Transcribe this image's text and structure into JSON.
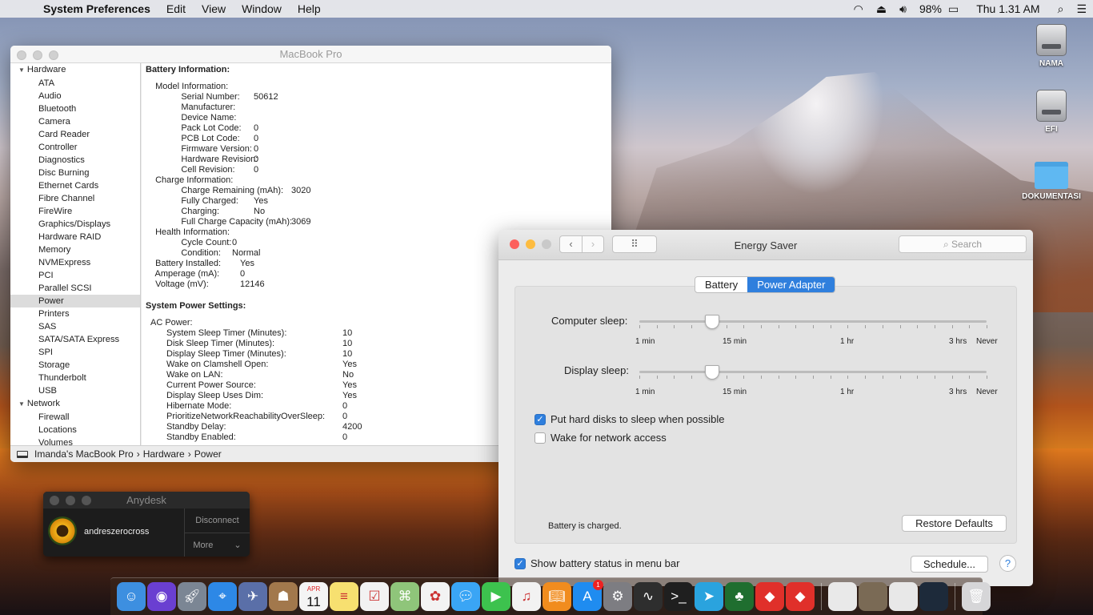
{
  "menubar": {
    "app_name": "System Preferences",
    "menus": [
      "Edit",
      "View",
      "Window",
      "Help"
    ],
    "battery_percent": "98%",
    "clock": "Thu 1.31 AM"
  },
  "desktop": {
    "icons": [
      "NAMA",
      "EFI",
      "DOKUMENTASI"
    ]
  },
  "sysinfo": {
    "title": "MacBook Pro",
    "sidebar": {
      "hardware_group": "Hardware",
      "items": [
        "ATA",
        "Audio",
        "Bluetooth",
        "Camera",
        "Card Reader",
        "Controller",
        "Diagnostics",
        "Disc Burning",
        "Ethernet Cards",
        "Fibre Channel",
        "FireWire",
        "Graphics/Displays",
        "Hardware RAID",
        "Memory",
        "NVMExpress",
        "PCI",
        "Parallel SCSI",
        "Power",
        "Printers",
        "SAS",
        "SATA/SATA Express",
        "SPI",
        "Storage",
        "Thunderbolt",
        "USB"
      ],
      "network_group": "Network",
      "network_items": [
        "Firewall",
        "Locations",
        "Volumes"
      ]
    },
    "battery_heading": "Battery Information:",
    "battery_rows": [
      {
        "k": "  Model Information:",
        "v": ""
      },
      {
        "k": "      Serial Number:",
        "v": "50612"
      },
      {
        "k": "      Manufacturer:",
        "v": ""
      },
      {
        "k": "      Device Name:",
        "v": ""
      },
      {
        "k": "      Pack Lot Code:",
        "v": "0"
      },
      {
        "k": "      PCB Lot Code:",
        "v": "0"
      },
      {
        "k": "      Firmware Version:",
        "v": "0"
      },
      {
        "k": "      Hardware Revision:",
        "v": "0"
      },
      {
        "k": "      Cell Revision:",
        "v": "0"
      },
      {
        "k": "  Charge Information:",
        "v": ""
      },
      {
        "k": "      Charge Remaining (mAh):",
        "v": "3020"
      },
      {
        "k": "      Fully Charged:",
        "v": "Yes"
      },
      {
        "k": "      Charging:",
        "v": "No"
      },
      {
        "k": "      Full Charge Capacity (mAh):",
        "v": "3069"
      },
      {
        "k": "  Health Information:",
        "v": ""
      },
      {
        "k": "      Cycle Count:",
        "v": "0"
      },
      {
        "k": "      Condition:",
        "v": "Normal"
      },
      {
        "k": "  Battery Installed:",
        "v": "Yes"
      },
      {
        "k": "  Amperage (mA):",
        "v": "0"
      },
      {
        "k": "  Voltage (mV):",
        "v": "12146"
      }
    ],
    "power_heading": "System Power Settings:",
    "ac_heading": "AC Power:",
    "ac_rows": [
      {
        "k": "System Sleep Timer (Minutes):",
        "v": "10"
      },
      {
        "k": "Disk Sleep Timer (Minutes):",
        "v": "10"
      },
      {
        "k": "Display Sleep Timer (Minutes):",
        "v": "10"
      },
      {
        "k": "Wake on Clamshell Open:",
        "v": "Yes"
      },
      {
        "k": "Wake on LAN:",
        "v": "No"
      },
      {
        "k": "Current Power Source:",
        "v": "Yes"
      },
      {
        "k": "Display Sleep Uses Dim:",
        "v": "Yes"
      },
      {
        "k": "Hibernate Mode:",
        "v": "0"
      },
      {
        "k": "PrioritizeNetworkReachabilityOverSleep:",
        "v": "0"
      },
      {
        "k": "Standby Delay:",
        "v": "4200"
      },
      {
        "k": "Standby Enabled:",
        "v": "0"
      }
    ],
    "path": [
      "Imanda's MacBook Pro",
      "Hardware",
      "Power"
    ]
  },
  "energy": {
    "title": "Energy Saver",
    "search_placeholder": "Search",
    "tabs": [
      "Battery",
      "Power Adapter"
    ],
    "active_tab": "Power Adapter",
    "computer_sleep_label": "Computer sleep:",
    "display_sleep_label": "Display sleep:",
    "tick_labels": [
      "1 min",
      "15 min",
      "1 hr",
      "3 hrs",
      "Never"
    ],
    "computer_sleep_value": "10 min",
    "display_sleep_value": "10 min",
    "hard_disks_label": "Put hard disks to sleep when possible",
    "hard_disks_checked": true,
    "wake_network_label": "Wake for network access",
    "wake_network_checked": false,
    "status": "Battery is charged.",
    "restore_button": "Restore Defaults",
    "show_battery_label": "Show battery status in menu bar",
    "show_battery_checked": true,
    "schedule_button": "Schedule...",
    "help": "?"
  },
  "anydesk": {
    "title": "Anydesk",
    "user": "andreszerocross",
    "disconnect": "Disconnect",
    "more": "More"
  },
  "dock": {
    "calendar_month": "APR",
    "calendar_day": "11",
    "appstore_badge": "1",
    "apps": [
      "finder-icon",
      "siri-icon",
      "launchpad-icon",
      "safari-icon",
      "mail-icon",
      "contacts-icon",
      "calendar-icon",
      "notes-icon",
      "reminders-icon",
      "maps-icon",
      "photos-icon",
      "messages-icon",
      "facetime-icon",
      "music-icon",
      "books-icon",
      "appstore-icon",
      "system-preferences-icon",
      "activity-monitor-icon",
      "terminal-icon",
      "telegram-icon",
      "clover-icon",
      "anydesk-icon",
      "anydesk-icon-2",
      "textedit-icon",
      "app-icon",
      "documents-icon",
      "screen-icon",
      "trash-icon"
    ]
  },
  "colors": {
    "accent": "#2f7fdd",
    "close": "#fc605c",
    "minimize": "#fdbc40",
    "zoom": "#c9c9c9"
  }
}
